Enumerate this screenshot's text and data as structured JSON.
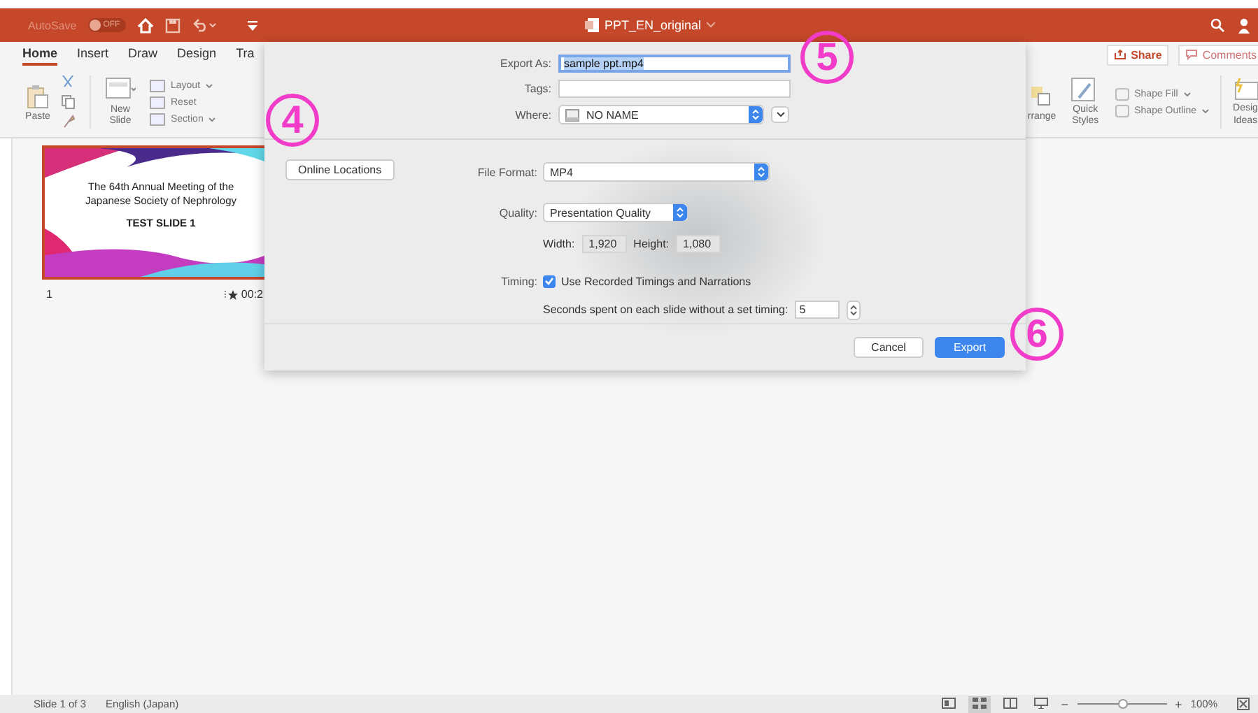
{
  "title_bar": {
    "autosave_label": "AutoSave",
    "autosave_state": "OFF",
    "autosave_on": false,
    "document_title": "PPT_EN_original"
  },
  "ribbon": {
    "tabs": [
      {
        "label": "Home",
        "selected": true
      },
      {
        "label": "Insert",
        "selected": false
      },
      {
        "label": "Draw",
        "selected": false
      },
      {
        "label": "Design",
        "selected": false
      },
      {
        "label": "Tra",
        "selected": false
      }
    ],
    "share": "Share",
    "comments": "Comments",
    "paste": "Paste",
    "new_slide": "New Slide",
    "layout": "Layout",
    "reset": "Reset",
    "section": "Section",
    "arrange": "rrange",
    "quick_styles": "Quick Styles",
    "shape_fill": "Shape Fill",
    "shape_outline": "Shape Outline",
    "design_ideas": [
      "Desig",
      "Ideas"
    ]
  },
  "slides": [
    {
      "number": "1",
      "title_lines": [
        "The 64th Annual Meeting of the",
        "Japanese Society of Nephrology"
      ],
      "subtitle": "TEST SLIDE 1",
      "timing": "00:2",
      "selected": true
    }
  ],
  "dialog": {
    "export_as_label": "Export As:",
    "export_as_value": "sample ppt.mp4",
    "tags_label": "Tags:",
    "where_label": "Where:",
    "where_value": "NO NAME",
    "online_locations": "Online Locations",
    "file_format_label": "File Format:",
    "file_format_value": "MP4",
    "quality_label": "Quality:",
    "quality_value": "Presentation Quality",
    "width_label": "Width:",
    "width_value": "1,920",
    "height_label": "Height:",
    "height_value": "1,080",
    "timing_label": "Timing:",
    "timing_checked": true,
    "timing_option": "Use Recorded Timings and Narrations",
    "seconds_label": "Seconds spent on each slide without a set timing:",
    "seconds_value": "5",
    "cancel": "Cancel",
    "export": "Export"
  },
  "annotations": [
    {
      "label": "4"
    },
    {
      "label": "5"
    },
    {
      "label": "6"
    }
  ],
  "status_bar": {
    "slide": "Slide 1 of 3",
    "language": "English (Japan)",
    "views": [
      {
        "kind": "normal",
        "selected": false
      },
      {
        "kind": "sorter",
        "selected": true
      },
      {
        "kind": "reading",
        "selected": false
      },
      {
        "kind": "slideshow",
        "selected": false
      }
    ],
    "zoom_out": "−",
    "zoom_in": "+",
    "zoom_slider": {
      "level": 0.5
    },
    "zoom": "100%"
  }
}
